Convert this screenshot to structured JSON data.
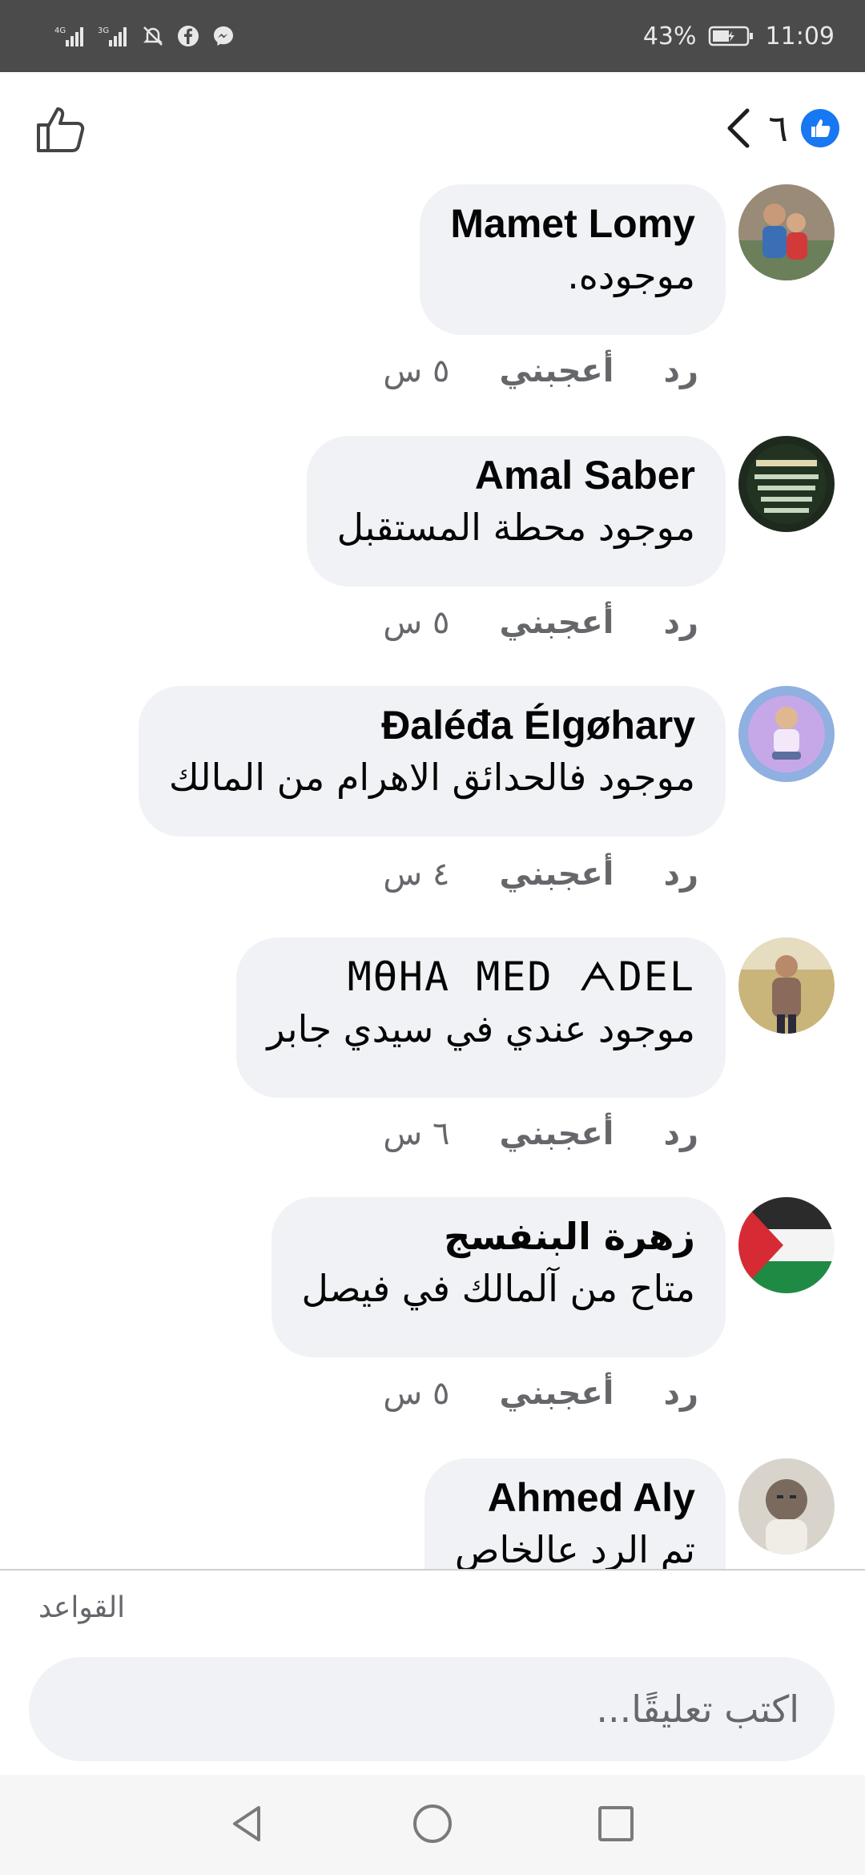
{
  "status_bar": {
    "network_1": "4G",
    "network_2": "3G",
    "battery": "43%",
    "time": "11:09"
  },
  "header": {
    "reaction_count": "٦",
    "icons": {
      "like": "thumbs-up-outline-icon",
      "back": "chevron-left-icon",
      "badge": "like-badge-icon"
    },
    "accent": "#1877f2"
  },
  "comments": [
    {
      "name": "Mamet Lomy",
      "text": "موجوده.",
      "time": "٥ س",
      "like": "أعجبني",
      "reply": "رد"
    },
    {
      "name": "Amal Saber",
      "text": "موجود محطة المستقبل",
      "time": "٥ س",
      "like": "أعجبني",
      "reply": "رد"
    },
    {
      "name": "Đaléđa Élgøhary",
      "text": "موجود فالحدائق الاهرام من المالك",
      "time": "٤ س",
      "like": "أعجبني",
      "reply": "رد"
    },
    {
      "name": "MӨHA MED ᗅDEL",
      "text": "موجود عندي في سيدي جابر",
      "time": "٦ س",
      "like": "أعجبني",
      "reply": "رد"
    },
    {
      "name": "زهرة البنفسج",
      "text": "متاح من آلمالك في فيصل",
      "time": "٥ س",
      "like": "أعجبني",
      "reply": "رد"
    },
    {
      "name": "Ahmed Aly",
      "text": "تم الرد عالخاص"
    }
  ],
  "footer": {
    "rules_label": "القواعد",
    "comment_placeholder": "اكتب تعليقًا..."
  },
  "navbar": {
    "icons": [
      "back-triangle-icon",
      "home-circle-icon",
      "recents-square-icon"
    ]
  }
}
